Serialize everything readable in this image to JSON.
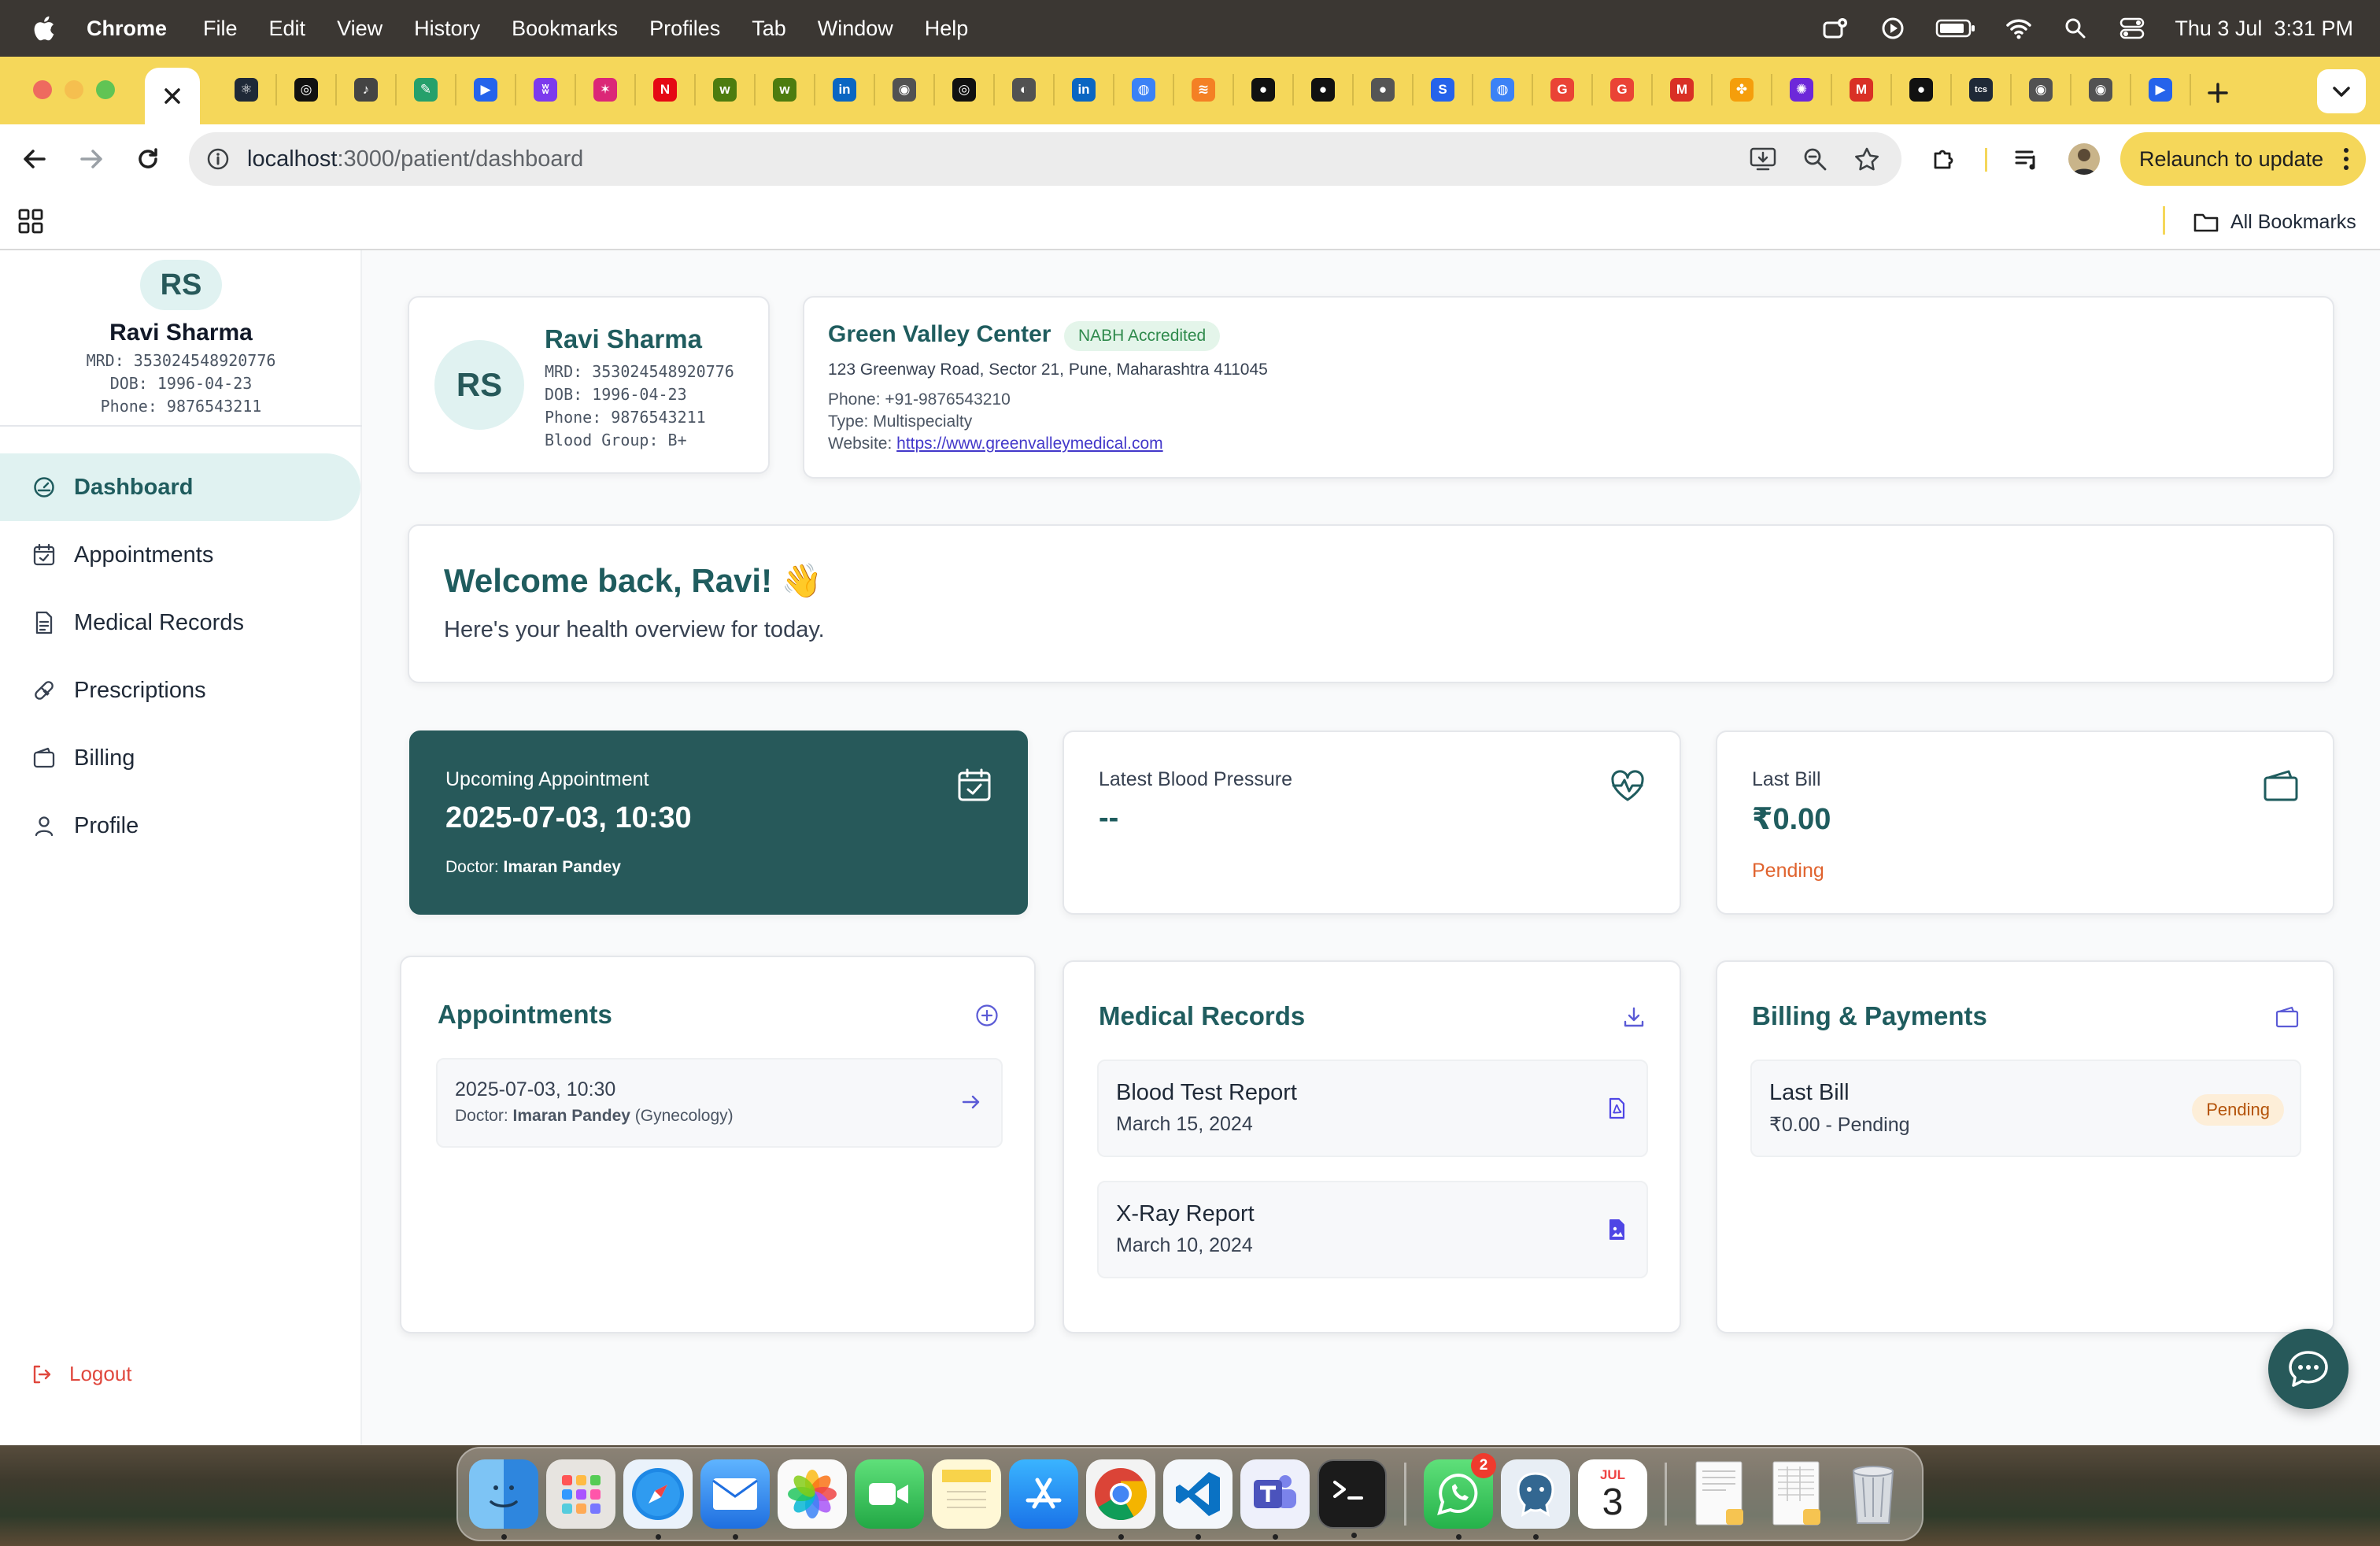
{
  "menubar": {
    "app_name": "Chrome",
    "items": [
      "File",
      "Edit",
      "View",
      "History",
      "Bookmarks",
      "Profiles",
      "Tab",
      "Window",
      "Help"
    ],
    "clock": "Thu 3 Jul  3:31 PM",
    "status_icons": [
      "hotspot-icon",
      "play-icon",
      "battery-icon",
      "wifi-icon",
      "spotlight-icon",
      "control-center-icon"
    ]
  },
  "tabs": {
    "active_tab_icon": "close-icon",
    "favicons": [
      {
        "name": "react-favicon",
        "color": "#1f2937",
        "glyph": "⚛"
      },
      {
        "name": "openai-favicon",
        "color": "#111111",
        "glyph": "◎"
      },
      {
        "name": "speaker-favicon",
        "color": "#444444",
        "glyph": "♪"
      },
      {
        "name": "feather-favicon",
        "color": "#25a06b",
        "glyph": "✎"
      },
      {
        "name": "play-favicon",
        "color": "#2563eb",
        "glyph": "▶"
      },
      {
        "name": "wings-favicon",
        "color": "#7c3aed",
        "glyph": "ʬ"
      },
      {
        "name": "star-app-favicon",
        "color": "#db2777",
        "glyph": "✶"
      },
      {
        "name": "netflix-favicon",
        "color": "#e50914",
        "glyph": "N"
      },
      {
        "name": "w-green-favicon",
        "color": "#4d7c0f",
        "glyph": "w"
      },
      {
        "name": "w-green-2-favicon",
        "color": "#4d7c0f",
        "glyph": "w"
      },
      {
        "name": "linkedin-favicon",
        "color": "#0a66c2",
        "glyph": "in"
      },
      {
        "name": "circle-logo-favicon",
        "color": "#525252",
        "glyph": "◉"
      },
      {
        "name": "openai-2-favicon",
        "color": "#111111",
        "glyph": "◎"
      },
      {
        "name": "globe-favicon",
        "color": "#525252",
        "glyph": "◐"
      },
      {
        "name": "linkedin-2-favicon",
        "color": "#0a66c2",
        "glyph": "in"
      },
      {
        "name": "spiral-favicon",
        "color": "#3b82f6",
        "glyph": "◍"
      },
      {
        "name": "stack-favicon",
        "color": "#f48024",
        "glyph": "≋"
      },
      {
        "name": "github-favicon",
        "color": "#111111",
        "glyph": "●"
      },
      {
        "name": "github-2-favicon",
        "color": "#111111",
        "glyph": "●"
      },
      {
        "name": "apple-favicon",
        "color": "#555555",
        "glyph": "●"
      },
      {
        "name": "s-favicon",
        "color": "#2563eb",
        "glyph": "S"
      },
      {
        "name": "spiral-2-favicon",
        "color": "#3b82f6",
        "glyph": "◍"
      },
      {
        "name": "google-favicon",
        "color": "#ea4335",
        "glyph": "G"
      },
      {
        "name": "google-2-favicon",
        "color": "#ea4335",
        "glyph": "G"
      },
      {
        "name": "gmail-favicon",
        "color": "#d93025",
        "glyph": "M"
      },
      {
        "name": "pinwheel-favicon",
        "color": "#f59e0b",
        "glyph": "✤"
      },
      {
        "name": "flower-favicon",
        "color": "#6d28d9",
        "glyph": "✺"
      },
      {
        "name": "gmail-2-favicon",
        "color": "#d93025",
        "glyph": "M"
      },
      {
        "name": "apple-2-favicon",
        "color": "#111111",
        "glyph": "●"
      },
      {
        "name": "tcs-favicon",
        "color": "#1f2937",
        "glyph": "tcs"
      },
      {
        "name": "circle-logo-2-favicon",
        "color": "#525252",
        "glyph": "◉"
      },
      {
        "name": "circle-logo-3-favicon",
        "color": "#525252",
        "glyph": "◉"
      },
      {
        "name": "play-2-favicon",
        "color": "#2563eb",
        "glyph": "▶"
      }
    ]
  },
  "toolbar": {
    "url_host": "localhost",
    "url_path": ":3000/patient/dashboard",
    "relaunch_label": "Relaunch to update"
  },
  "bookmarks": {
    "all_bookmarks_label": "All Bookmarks"
  },
  "sidebar": {
    "avatar_initials": "RS",
    "name": "Ravi Sharma",
    "mrd": "MRD: 353024548920776",
    "dob": "DOB: 1996-04-23",
    "phone": "Phone: 9876543211",
    "nav": [
      {
        "label": "Dashboard",
        "icon": "gauge-icon"
      },
      {
        "label": "Appointments",
        "icon": "calendar-check-icon"
      },
      {
        "label": "Medical Records",
        "icon": "document-icon"
      },
      {
        "label": "Prescriptions",
        "icon": "pill-icon"
      },
      {
        "label": "Billing",
        "icon": "wallet-icon"
      },
      {
        "label": "Profile",
        "icon": "user-icon"
      }
    ],
    "logout_label": "Logout"
  },
  "patient_card": {
    "initials": "RS",
    "name": "Ravi Sharma",
    "mrd": "MRD: 353024548920776",
    "dob": "DOB: 1996-04-23",
    "phone": "Phone: 9876543211",
    "blood_group": "Blood Group: B+"
  },
  "center_card": {
    "name": "Green Valley Center",
    "badge": "NABH Accredited",
    "address": "123 Greenway Road, Sector 21, Pune, Maharashtra 411045",
    "phone": "Phone: +91-9876543210",
    "type": "Type: Multispecialty",
    "website_label": "Website: ",
    "website_url": "https://www.greenvalleymedical.com"
  },
  "welcome": {
    "title": "Welcome back, Ravi! 👋",
    "subtitle": "Here's your health overview for today."
  },
  "stats": {
    "appointment": {
      "label": "Upcoming Appointment",
      "value": "2025-07-03, 10:30",
      "doctor_prefix": "Doctor: ",
      "doctor": "Imaran Pandey"
    },
    "blood_pressure": {
      "label": "Latest Blood Pressure",
      "value": "--"
    },
    "last_bill": {
      "label": "Last Bill",
      "value": "₹0.00",
      "status": "Pending"
    }
  },
  "appointments_panel": {
    "title": "Appointments",
    "items": [
      {
        "datetime": "2025-07-03, 10:30",
        "doctor_prefix": "Doctor: ",
        "doctor": "Imaran Pandey",
        "specialty": " (Gynecology)"
      }
    ]
  },
  "records_panel": {
    "title": "Medical Records",
    "items": [
      {
        "title": "Blood Test Report",
        "date": "March 15, 2024",
        "icon": "pdf-file-icon"
      },
      {
        "title": "X-Ray Report",
        "date": "March 10, 2024",
        "icon": "image-file-icon"
      }
    ]
  },
  "billing_panel": {
    "title": "Billing & Payments",
    "items": [
      {
        "title": "Last Bill",
        "amount": "₹0.00 - Pending",
        "status": "Pending"
      }
    ]
  },
  "dock": {
    "calendar_month": "JUL",
    "calendar_day": "3",
    "whatsapp_badge": "2",
    "apps": [
      "finder-icon",
      "launchpad-icon",
      "safari-icon",
      "mail-icon",
      "photos-icon",
      "facetime-icon",
      "notes-icon",
      "app-store-icon",
      "chrome-icon",
      "vscode-icon",
      "teams-icon",
      "terminal-icon",
      "whatsapp-icon",
      "postgres-icon",
      "calendar-icon",
      "document-icon",
      "spreadsheet-icon",
      "trash-icon"
    ]
  },
  "colors": {
    "brand_teal": "#27595a",
    "accent_light": "#e0f2f1",
    "pending_orange": "#e0632e",
    "tab_strip_yellow": "#f5d75a"
  }
}
